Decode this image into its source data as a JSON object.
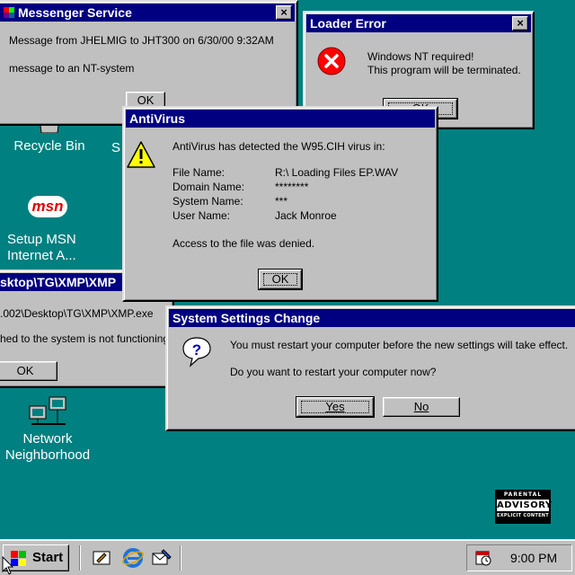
{
  "desktop": {
    "icons": [
      {
        "label": "Recycle Bin"
      },
      {
        "label": "Setup MSN Internet A..."
      },
      {
        "label": "Network Neighborhood"
      }
    ],
    "msn_logo": "msn",
    "partial_icon_label": "S"
  },
  "windows": {
    "messenger": {
      "title": "Messenger Service",
      "line1": "Message from JHELMIG to JHT300 on 6/30/00 9:32AM",
      "line2": "message to an NT-system",
      "ok": "OK"
    },
    "loader": {
      "title": "Loader Error",
      "line1": "Windows NT required!",
      "line2": "This program will be terminated.",
      "ok": "OK",
      "icon": "error-icon"
    },
    "antivirus": {
      "title": "AntiVirus",
      "headline": "AntiVirus has detected the W95.CIH virus in:",
      "fields": [
        {
          "label": "File Name:",
          "value": "R:\\ Loading Files EP.WAV"
        },
        {
          "label": "Domain Name:",
          "value": "********"
        },
        {
          "label": "System Name:",
          "value": "***"
        },
        {
          "label": "User Name:",
          "value": "Jack Monroe"
        }
      ],
      "footer": "Access to the file was denied.",
      "ok": "OK",
      "icon": "warning-icon"
    },
    "explorer": {
      "title": "sktop\\TG\\XMP\\XMP",
      "path": ".002\\Desktop\\TG\\XMP\\XMP.exe",
      "message": "hed to the system is not functioning",
      "ok": "OK"
    },
    "settings": {
      "title": "System Settings Change",
      "line1": "You must restart your computer before the new settings will take effect.",
      "line2": "Do you want to restart your computer now?",
      "yes": "Yes",
      "no": "No",
      "icon": "question-icon"
    }
  },
  "advisory": {
    "top": "PARENTAL",
    "middle": "ADVISORY",
    "bottom": "EXPLICIT CONTENT"
  },
  "taskbar": {
    "start_label": "Start",
    "clock": "9:00 PM"
  },
  "colors": {
    "desktop": "#008080",
    "title_active": "#000080",
    "window_face": "#c0c0c0"
  }
}
